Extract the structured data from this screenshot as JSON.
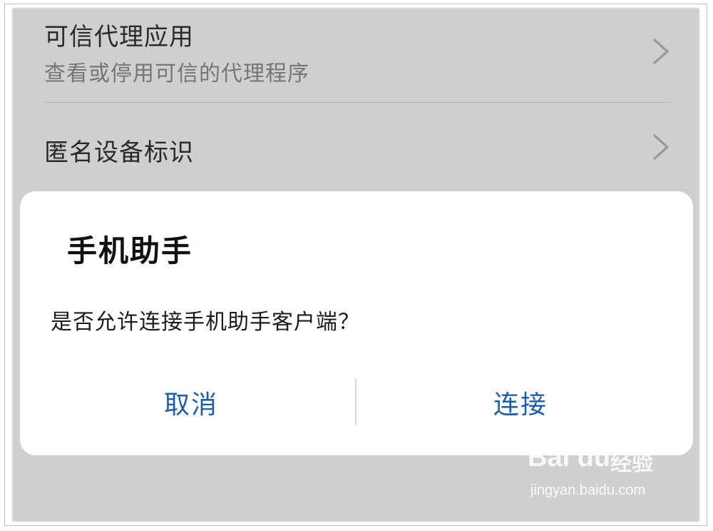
{
  "settings": {
    "items": [
      {
        "title": "可信代理应用",
        "subtitle": "查看或停用可信的代理程序"
      },
      {
        "title": "匿名设备标识",
        "subtitle": ""
      }
    ]
  },
  "dialog": {
    "title": "手机助手",
    "message": "是否允许连接手机助手客户端？",
    "cancel_label": "取消",
    "confirm_label": "连接"
  },
  "watermark": {
    "logo": "Bai du",
    "brand_cn": "经验",
    "url": "jingyan.baidu.com"
  },
  "colors": {
    "overlay_bg": "#cfcfcf",
    "dialog_bg": "#ffffff",
    "button_text": "#1f5ea8",
    "subtitle_text": "#767676"
  },
  "icons": {
    "row_arrow": "chevron-right-icon",
    "watermark_mark": "paw-icon"
  }
}
